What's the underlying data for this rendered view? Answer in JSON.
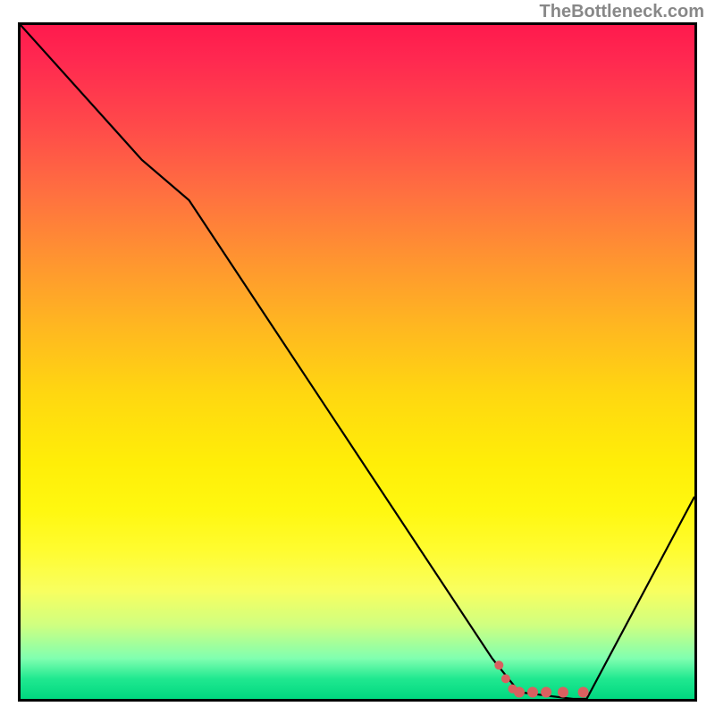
{
  "watermark": "TheBottleneck.com",
  "chart_data": {
    "type": "line",
    "title": "",
    "xlabel": "",
    "ylabel": "",
    "xlim": [
      0,
      100
    ],
    "ylim": [
      0,
      100
    ],
    "series": [
      {
        "name": "curve",
        "x": [
          0,
          18,
          25,
          70,
          74,
          82,
          84,
          100
        ],
        "values": [
          100,
          80,
          74,
          6,
          1,
          0,
          0,
          30
        ]
      }
    ],
    "markers": {
      "name": "dots",
      "color": "#d96060",
      "points": [
        {
          "x": 71,
          "y": 5
        },
        {
          "x": 72,
          "y": 3
        },
        {
          "x": 73,
          "y": 1.5
        },
        {
          "x": 74,
          "y": 1
        },
        {
          "x": 76,
          "y": 1
        },
        {
          "x": 78,
          "y": 1
        },
        {
          "x": 80.5,
          "y": 1
        },
        {
          "x": 83.5,
          "y": 1
        }
      ]
    }
  }
}
